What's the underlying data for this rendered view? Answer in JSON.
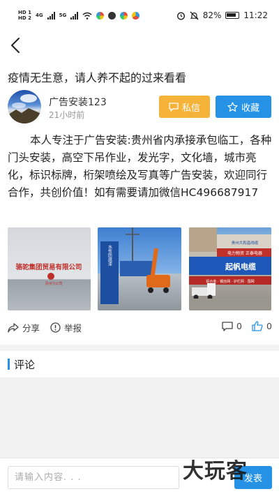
{
  "status_bar": {
    "sim1": "HD 1",
    "sim2": "HD 2",
    "network1": "4G",
    "network2": "5G",
    "battery_percent": "82%",
    "time": "11:22"
  },
  "post": {
    "title": "疫情无生意，请人养不起的过来看看",
    "author": "广告安装123",
    "time_ago": "21小时前",
    "content": "本人专注于广告安装:贵州省内承接承包临工，各种门头安装，高空下吊作业，发光字，文化墙，城市亮化，标识标牌，桁架喷绘及写真等广告安装，欢迎同行合作，共创价值！如有需要请加微信HC496687917",
    "photos": [
      {
        "sign_line1": "骆驼集团贸易有限公司",
        "sign_line2": "贵州分公司"
      },
      {
        "sign_text": "水性防腐漆"
      },
      {
        "sign_line1": "贵州大和昌线缆",
        "sign_line2": "电力物资  正泰电器",
        "sign_main": "起帆电缆",
        "sign_line3": "铝合金 · 钢丝网 · 护栏网 · 围网"
      }
    ]
  },
  "buttons": {
    "message": "私信",
    "favorite": "收藏"
  },
  "actions": {
    "share": "分享",
    "report": "举报",
    "comment_count": "0",
    "like_count": "0"
  },
  "comments": {
    "section_title": "评论"
  },
  "input": {
    "placeholder": "请输入内容. . .",
    "send_label": "发表"
  },
  "watermark": "大玩客",
  "colors": {
    "accent_blue": "#2592e6",
    "message_orange": "#f6b33a"
  },
  "icons": [
    "back-arrow-icon",
    "chat-icon",
    "star-icon",
    "share-icon",
    "alert-icon",
    "comment-icon",
    "thumbs-up-icon"
  ]
}
